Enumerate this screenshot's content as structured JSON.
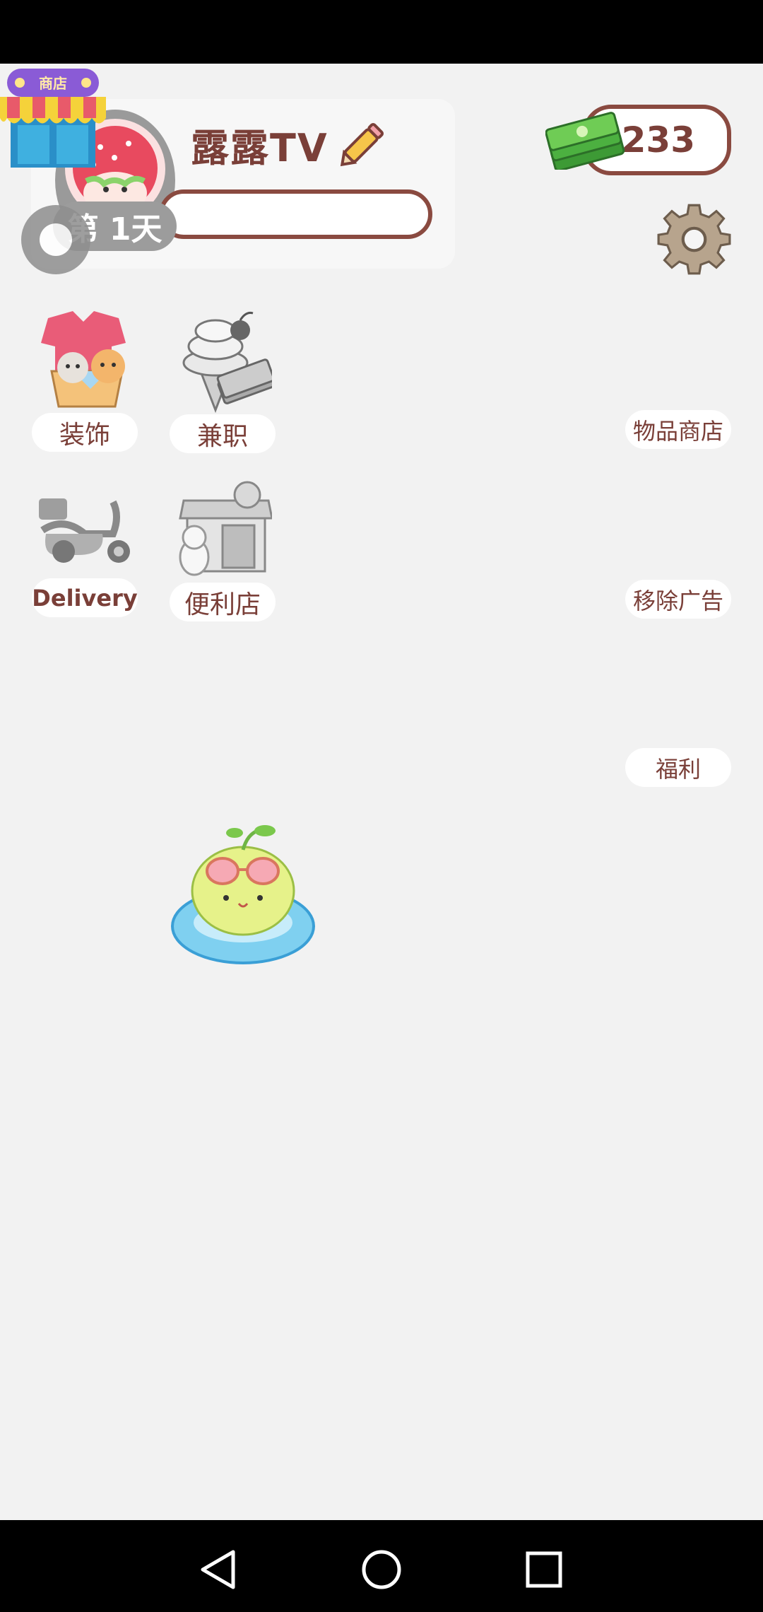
{
  "profile": {
    "name": "露露TV",
    "day_label": "第 1天"
  },
  "shop_badge_label": "商店",
  "money": {
    "amount": "233"
  },
  "menu_left": [
    {
      "label": "装饰",
      "icon": "clothes-cats-basket-icon"
    },
    {
      "label": "兼职",
      "icon": "ice-cream-money-icon"
    },
    {
      "label": "Delivery",
      "icon": "scooter-icon"
    },
    {
      "label": "便利店",
      "icon": "convenience-store-icon"
    }
  ],
  "menu_right": [
    {
      "label": "物品商店"
    },
    {
      "label": "移除广告"
    },
    {
      "label": "福利"
    }
  ],
  "colors": {
    "brown_text": "#7a3f38",
    "background": "#f2f2f2",
    "money_green": "#5fbf45"
  }
}
